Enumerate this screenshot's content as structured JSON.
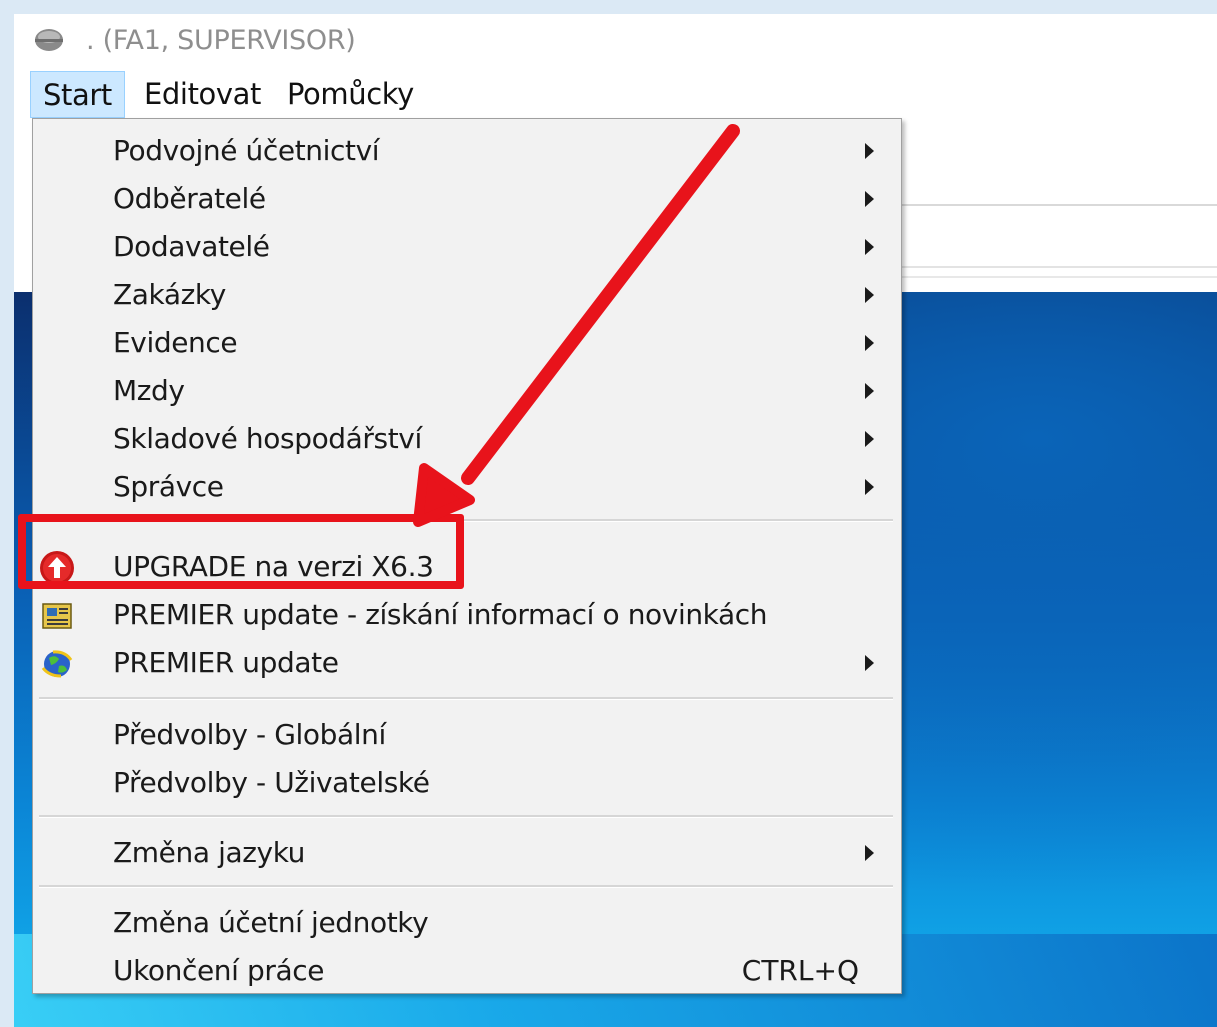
{
  "window": {
    "title": ". (FA1, SUPERVISOR)"
  },
  "menubar": {
    "items": [
      {
        "label": "Start"
      },
      {
        "label": "Editovat"
      },
      {
        "label": "Pomůcky"
      }
    ]
  },
  "dropdown": {
    "items": [
      {
        "label": "Podvojné účetnictví",
        "submenu": true
      },
      {
        "label": "Odběratelé",
        "submenu": true
      },
      {
        "label": "Dodavatelé",
        "submenu": true
      },
      {
        "label": "Zakázky",
        "submenu": true
      },
      {
        "label": "Evidence",
        "submenu": true
      },
      {
        "label": "Mzdy",
        "submenu": true
      },
      {
        "label": "Skladové hospodářství",
        "submenu": true
      },
      {
        "label": "Správce",
        "submenu": true
      },
      {
        "label": "UPGRADE na verzi X6.3",
        "icon": "upgrade-arrow-icon"
      },
      {
        "label": "PREMIER update - získání informací o novinkách",
        "icon": "news-icon"
      },
      {
        "label": "PREMIER update",
        "icon": "globe-update-icon",
        "submenu": true
      },
      {
        "label": "Předvolby - Globální"
      },
      {
        "label": "Předvolby - Uživatelské"
      },
      {
        "label": "Změna jazyku",
        "submenu": true
      },
      {
        "label": "Změna účetní jednotky"
      },
      {
        "label": "Ukončení práce",
        "shortcut": "CTRL+Q"
      }
    ]
  },
  "colors": {
    "highlight": "#e8131b",
    "menu_active": "#cce8ff",
    "menu_bg": "#f2f2f2"
  }
}
